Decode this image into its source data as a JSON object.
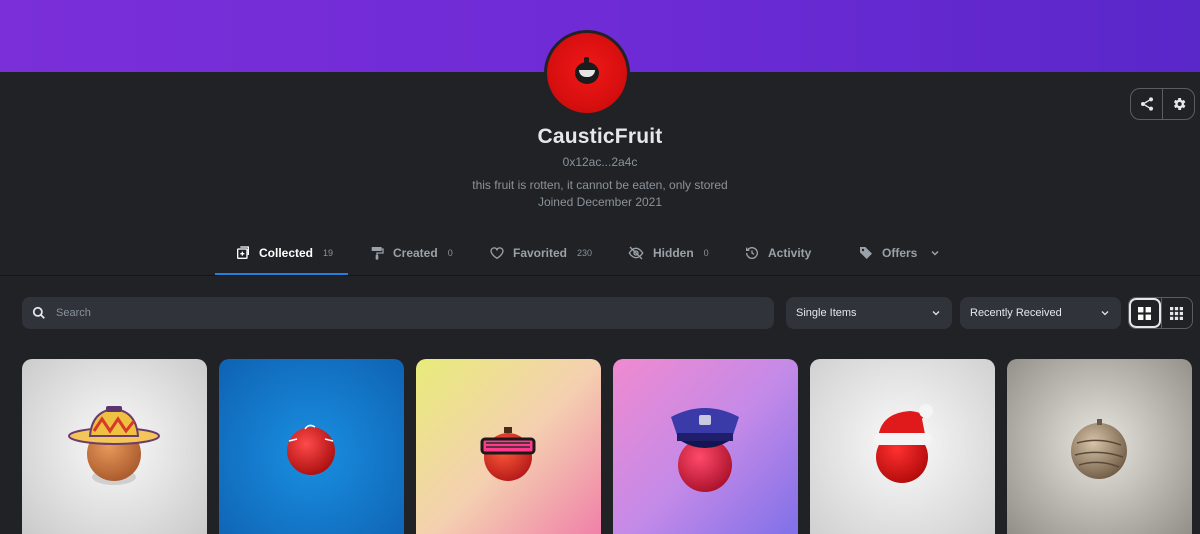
{
  "colors": {
    "banner": "#7a2fd8",
    "background": "#202225",
    "accent": "#2081e2",
    "avatar": "#e01010"
  },
  "profile": {
    "name": "CausticFruit",
    "address": "0x12ac...2a4c",
    "bio": "this fruit is rotten, it cannot be eaten, only stored",
    "joined": "Joined December 2021",
    "actions": [
      {
        "icon": "share-icon"
      },
      {
        "icon": "gear-icon"
      }
    ]
  },
  "tabs": [
    {
      "label": "Collected",
      "count": "19",
      "icon": "collected-icon",
      "active": true
    },
    {
      "label": "Created",
      "count": "0",
      "icon": "paint-roller-icon",
      "active": false
    },
    {
      "label": "Favorited",
      "count": "230",
      "icon": "heart-icon",
      "active": false
    },
    {
      "label": "Hidden",
      "count": "0",
      "icon": "eye-off-icon",
      "active": false
    },
    {
      "label": "Activity",
      "count": "",
      "icon": "history-icon",
      "active": false
    },
    {
      "label": "Offers",
      "count": "",
      "icon": "tag-icon",
      "active": false
    }
  ],
  "filters": {
    "search_placeholder": "Search",
    "items_select": "Single Items",
    "sort_select": "Recently Received",
    "view_modes": [
      "large-grid-icon",
      "small-grid-icon"
    ],
    "active_view": "large-grid-icon"
  },
  "items": [
    {
      "background": "white-grey",
      "fruit": "orange",
      "accessory": "bucket-hat"
    },
    {
      "background": "blue",
      "fruit": "red",
      "accessory": "none"
    },
    {
      "background": "yellow-pink",
      "fruit": "red",
      "accessory": "shutter-shades"
    },
    {
      "background": "pink-purple",
      "fruit": "red",
      "accessory": "police-cap"
    },
    {
      "background": "white-grey",
      "fruit": "red",
      "accessory": "santa-hat"
    },
    {
      "background": "grey",
      "fruit": "tan",
      "accessory": "none"
    }
  ]
}
